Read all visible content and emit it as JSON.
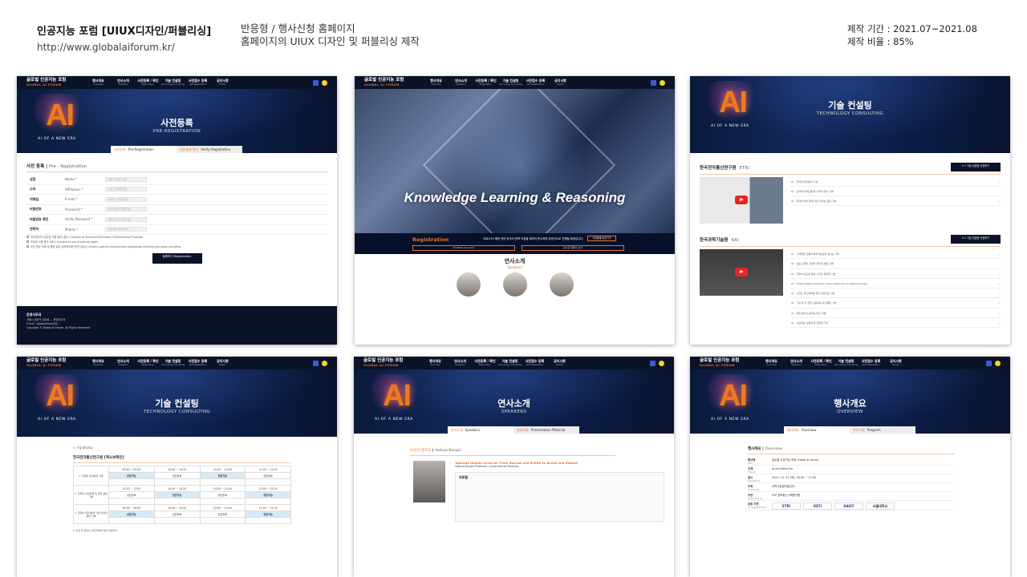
{
  "header": {
    "title": "인공지능 포럼 [UIUX디자인/퍼블리싱]",
    "url": "http://www.globalaiforum.kr/",
    "desc1": "반응형 / 행사신청 홈페이지",
    "desc2": "홈페이지의 UIUX 디자인 및 퍼블리싱 제작",
    "period": "제작 기간 : 2021.07~2021.08",
    "ratio": "제작 비율 : 85%"
  },
  "site": {
    "logo_kr": "글로벌 인공지능 포럼",
    "logo_en": "GLOBAL AI FORUM",
    "ai_text": "AI",
    "ai_sub": "AI OF A NEW ERA",
    "nav": [
      {
        "kr": "행사개요",
        "en": "Overview"
      },
      {
        "kr": "연사소개",
        "en": "Speakers"
      },
      {
        "kr": "사전등록 / 확인",
        "en": "Registration"
      },
      {
        "kr": "기술 컨설팅",
        "en": "Technology Consulting"
      },
      {
        "kr": "사전접수 등록",
        "en": "Add Registration"
      },
      {
        "kr": "공지사항",
        "en": "Notice"
      }
    ],
    "colors": {
      "accent": "#e8742c",
      "navy": "#0a1328"
    }
  },
  "shot1": {
    "title": "사전등록",
    "subtitle": "PRE-REGISTRATION",
    "tab1": "사전등록",
    "tab1_en": "Pre-Registration",
    "tab2": "사전등록 확인",
    "tab2_en": "Verify Registration",
    "section": "사전 등록",
    "section_en": "Pre - Registration",
    "fields": [
      {
        "k": "성함",
        "e": "Name *",
        "ph": "이름을 입력해주세요"
      },
      {
        "k": "소속",
        "e": "Affiliation *",
        "ph": "소속을 입력해주세요"
      },
      {
        "k": "이메일",
        "e": "E-mail *",
        "ph": "이메일을 입력해주세요"
      },
      {
        "k": "비밀번호",
        "e": "Password *",
        "ph": "비밀번호를 입력해주세요"
      },
      {
        "k": "비밀번호 확인",
        "e": "Verify Password *",
        "ph": "비밀번호를 입력해주세요"
      },
      {
        "k": "연락처",
        "e": "Mobile *",
        "ph": "연락처를 입력해주세요"
      }
    ],
    "checks": [
      "개인정보의 수집 및 이용 동의 (필수) Consent to Personal Information Collection/Use Purposes",
      "초상권 사용 동의 (필수) Consent to use of portrait rights",
      "무단 영상 녹화 및 불법 유포 금지에 대한 동의 (필수) Consent against unauthorized video/photo shooting and audio recording"
    ],
    "button": "등록하기 Registration",
    "footer_title": "운영사무국",
    "footer_lines": [
      "서울시 강남구 삼성로 … 운영사무국",
      "E-mail : globalaiforum@…",
      "Copyright © Global AI Forum. All Rights Reserved."
    ]
  },
  "shot2": {
    "hero_text": "Knowledge Learning & Reasoning",
    "reg_label": "Registration",
    "reg_desc": "코로나19 예방 관련 방국의 방역 지침을 철저히 준수하며 온라인으로 진행될 예정입니다.",
    "reg_btn": "사전등록 바로가기",
    "yt1": "YouTube Live Link",
    "yt2": "실시간 유튜브 보기",
    "spk_title": "연사소개",
    "spk_en": "Speakers"
  },
  "shot3": {
    "title": "기술 컨설팅",
    "subtitle": "TECHNOLOGY CONSULTING",
    "org1": "한국전자통신연구원",
    "org1_en": "ETRI",
    "org2": "한국과학기술원",
    "org2_en": "KAI",
    "btn": "1:1 기술 컨설팅 신청하기",
    "list1": [
      "한국어 언어분석 기술",
      "한국어 언어모델 및 다국어 질의 기술",
      "한국어 의미 탐색 기반 딥러닝 응답 기술"
    ],
    "list2": [
      "기계학습 모델의 해석가능성을 높이는 기술",
      "심층 신경망 기반의 데이터 생성 기술",
      "학습의 속도를 향상 시키는 최적화 기술",
      "Interpretable Computer Aided Diagnosis for Medical Image",
      "스마트 헬스케어를 위한 인공지능 기술",
      "고속 및 저 전력 인공지능 하드웨어 기술",
      "로봇 분야 인공지능 연구 기술",
      "인공지능 신뢰성 및 안전성 기술"
    ]
  },
  "shot4": {
    "title": "기술 컨설팅",
    "subtitle": "TECHNOLOGY CONSULTING",
    "back": "< 기업 페이지로",
    "org": "한국전자통신연구원 [엑소브레인]",
    "times1": [
      "09:30 ~ 09:50",
      "10:00 ~ 10:20",
      "10:30 ~ 10:50",
      "11:00 ~ 11:20"
    ],
    "times2": [
      "13:30 ~ 13:50",
      "14:00 ~ 14:20",
      "14:30 ~ 14:50",
      "15:00 ~ 15:20"
    ],
    "rows": [
      "1. 한국어 언어분석 기술",
      "2. 한국어 언어모델 및 질의 응답 기술",
      "3. 한국어 의미 탐색 기반 딥러닝 응답 기술"
    ],
    "avail": "상담가능",
    "done": "상담완료",
    "note": "※ 신청 후 문의는 담당자에게 연락 바랍니다."
  },
  "shot5": {
    "title": "연사소개",
    "subtitle": "SPEAKERS",
    "tab1": "연사소개",
    "tab1_en": "Speakers",
    "tab2": "발표자료",
    "tab2_en": "Presentation Material",
    "name_kr": "요슈아 벤지오",
    "name_en": "Yoshua Bengio",
    "talk": "Towards Human-Level AI: From Narrow and Brittle to Broad and Robust",
    "affil": "Yoshua Bengio Professor, Université de Montréal",
    "profile": "프로필"
  },
  "shot6": {
    "title": "행사개요",
    "subtitle": "OVERVIEW",
    "tab1": "행사개요",
    "tab1_en": "Overview",
    "tab2": "프로그램",
    "tab2_en": "Program",
    "section": "행사개요",
    "section_en": "Overview",
    "rows": [
      {
        "k": "행사명",
        "e": "Title",
        "v": "글로벌 인공지능 포럼 Global AI Forum"
      },
      {
        "k": "주제",
        "e": "Theme",
        "v": "AI of a New Era"
      },
      {
        "k": "일시",
        "e": "Date&Time",
        "v": "2021. 10. 21 (목), 09:30 ~ 17:00"
      },
      {
        "k": "주최",
        "e": "Hosted by",
        "v": "과학기술정보통신부"
      },
      {
        "k": "주관",
        "e": "Organized by",
        "v": "IITP 정보통신기획평가원"
      },
      {
        "k": "공동 주관",
        "e": "Co-organized by",
        "v": "ETRI · KETI · KAIST · 서울대학교"
      }
    ],
    "logos": [
      "ETRI",
      "KETI",
      "KAIST",
      "서울대학교"
    ]
  }
}
